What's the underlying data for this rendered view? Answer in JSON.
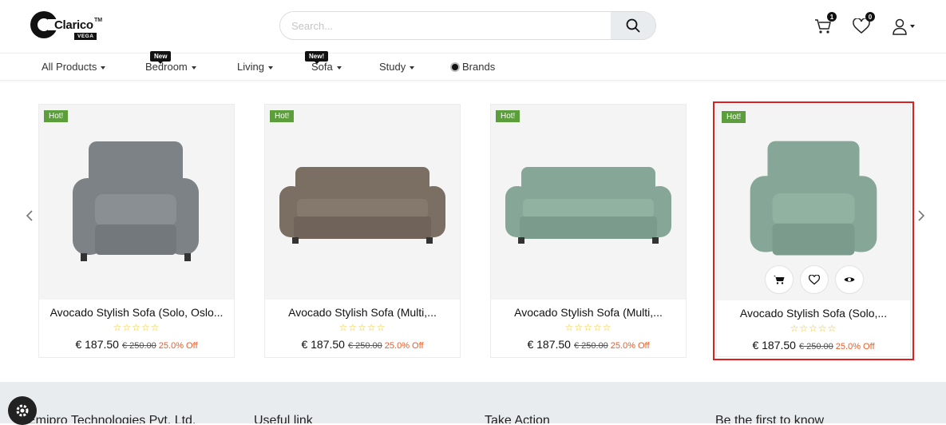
{
  "header": {
    "logo_text": "Clarico",
    "logo_tm": "TM",
    "logo_sub": "VEGA",
    "search_placeholder": "Search...",
    "cart_count": "1",
    "wishlist_count": "0"
  },
  "nav": {
    "items": [
      {
        "label": "All Products",
        "tag": ""
      },
      {
        "label": "Bedroom",
        "tag": "New"
      },
      {
        "label": "Living",
        "tag": ""
      },
      {
        "label": "Sofa",
        "tag": "New!"
      },
      {
        "label": "Study",
        "tag": ""
      },
      {
        "label": "Brands",
        "tag": ""
      }
    ]
  },
  "products": [
    {
      "badge": "Hot!",
      "name": "Avocado Stylish Sofa (Solo, Oslo...",
      "stars": "☆☆☆☆☆",
      "price": "€ 187.50",
      "old_price": "€ 250.00",
      "discount": "25.0% Off",
      "color": "#7d8287"
    },
    {
      "badge": "Hot!",
      "name": "Avocado Stylish Sofa (Multi,...",
      "stars": "☆☆☆☆☆",
      "price": "€ 187.50",
      "old_price": "€ 250.00",
      "discount": "25.0% Off",
      "color": "#7b6e63"
    },
    {
      "badge": "Hot!",
      "name": "Avocado Stylish Sofa (Multi,...",
      "stars": "☆☆☆☆☆",
      "price": "€ 187.50",
      "old_price": "€ 250.00",
      "discount": "25.0% Off",
      "color": "#86a797"
    },
    {
      "badge": "Hot!",
      "name": "Avocado Stylish Sofa (Solo,...",
      "stars": "☆☆☆☆☆",
      "price": "€ 187.50",
      "old_price": "€ 250.00",
      "discount": "25.0% Off",
      "color": "#86a797"
    }
  ],
  "footer": {
    "columns": [
      "Emipro Technologies Pvt. Ltd.",
      "Useful link",
      "Take Action",
      "Be the first to know"
    ]
  }
}
